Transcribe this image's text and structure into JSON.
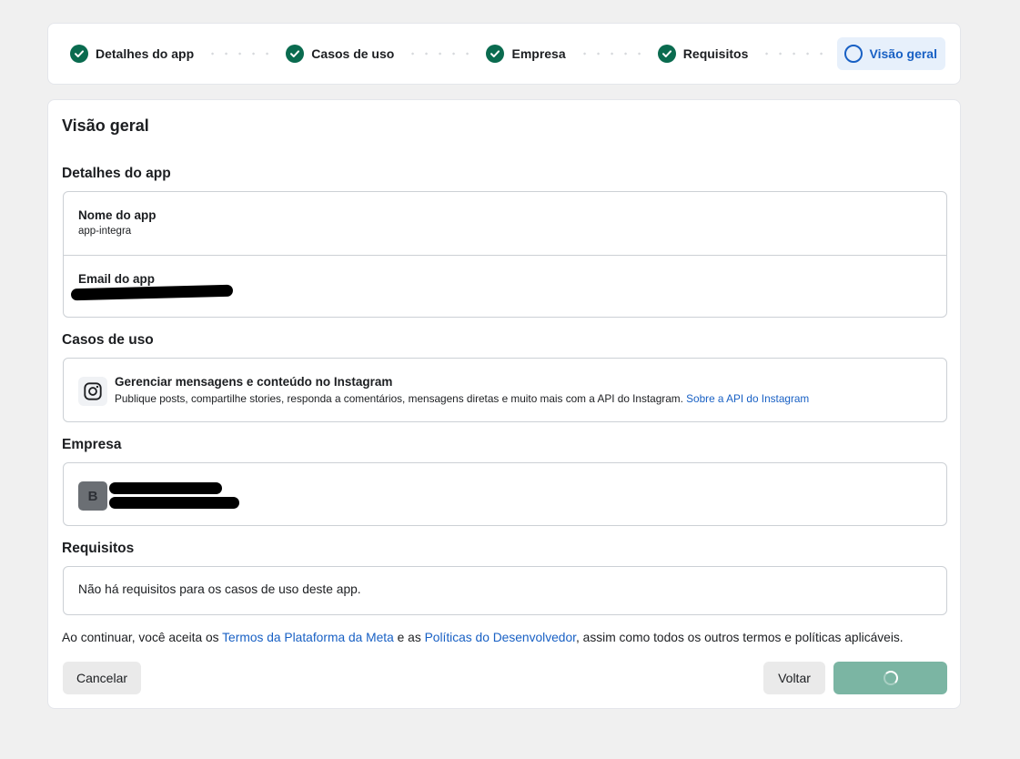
{
  "stepper": {
    "steps": [
      {
        "label": "Detalhes do app",
        "status": "done"
      },
      {
        "label": "Casos de uso",
        "status": "done"
      },
      {
        "label": "Empresa",
        "status": "done"
      },
      {
        "label": "Requisitos",
        "status": "done"
      },
      {
        "label": "Visão geral",
        "status": "current"
      }
    ]
  },
  "main": {
    "title": "Visão geral",
    "app_details": {
      "section_title": "Detalhes do app",
      "name_label": "Nome do app",
      "name_value": "app-integra",
      "email_label": "Email do app"
    },
    "use_cases": {
      "section_title": "Casos de uso",
      "icon": "instagram-icon",
      "title": "Gerenciar mensagens e conteúdo no Instagram",
      "description": "Publique posts, compartilhe stories, responda a comentários, mensagens diretas e muito mais com a API do Instagram.",
      "link": "Sobre a API do Instagram"
    },
    "business": {
      "section_title": "Empresa",
      "avatar_letter": "B"
    },
    "requirements": {
      "section_title": "Requisitos",
      "text": "Não há requisitos para os casos de uso deste app."
    },
    "terms": {
      "prefix": "Ao continuar, você aceita os ",
      "link1": "Termos da Plataforma da Meta",
      "middle": " e as ",
      "link2": "Políticas do Desenvolvedor",
      "suffix": ", assim como todos os outros termos e políticas aplicáveis."
    },
    "buttons": {
      "cancel": "Cancelar",
      "back": "Voltar"
    }
  },
  "colors": {
    "accent": "#1860c4",
    "success": "#0a6b4f",
    "primary_disabled": "#7bb5a3"
  }
}
